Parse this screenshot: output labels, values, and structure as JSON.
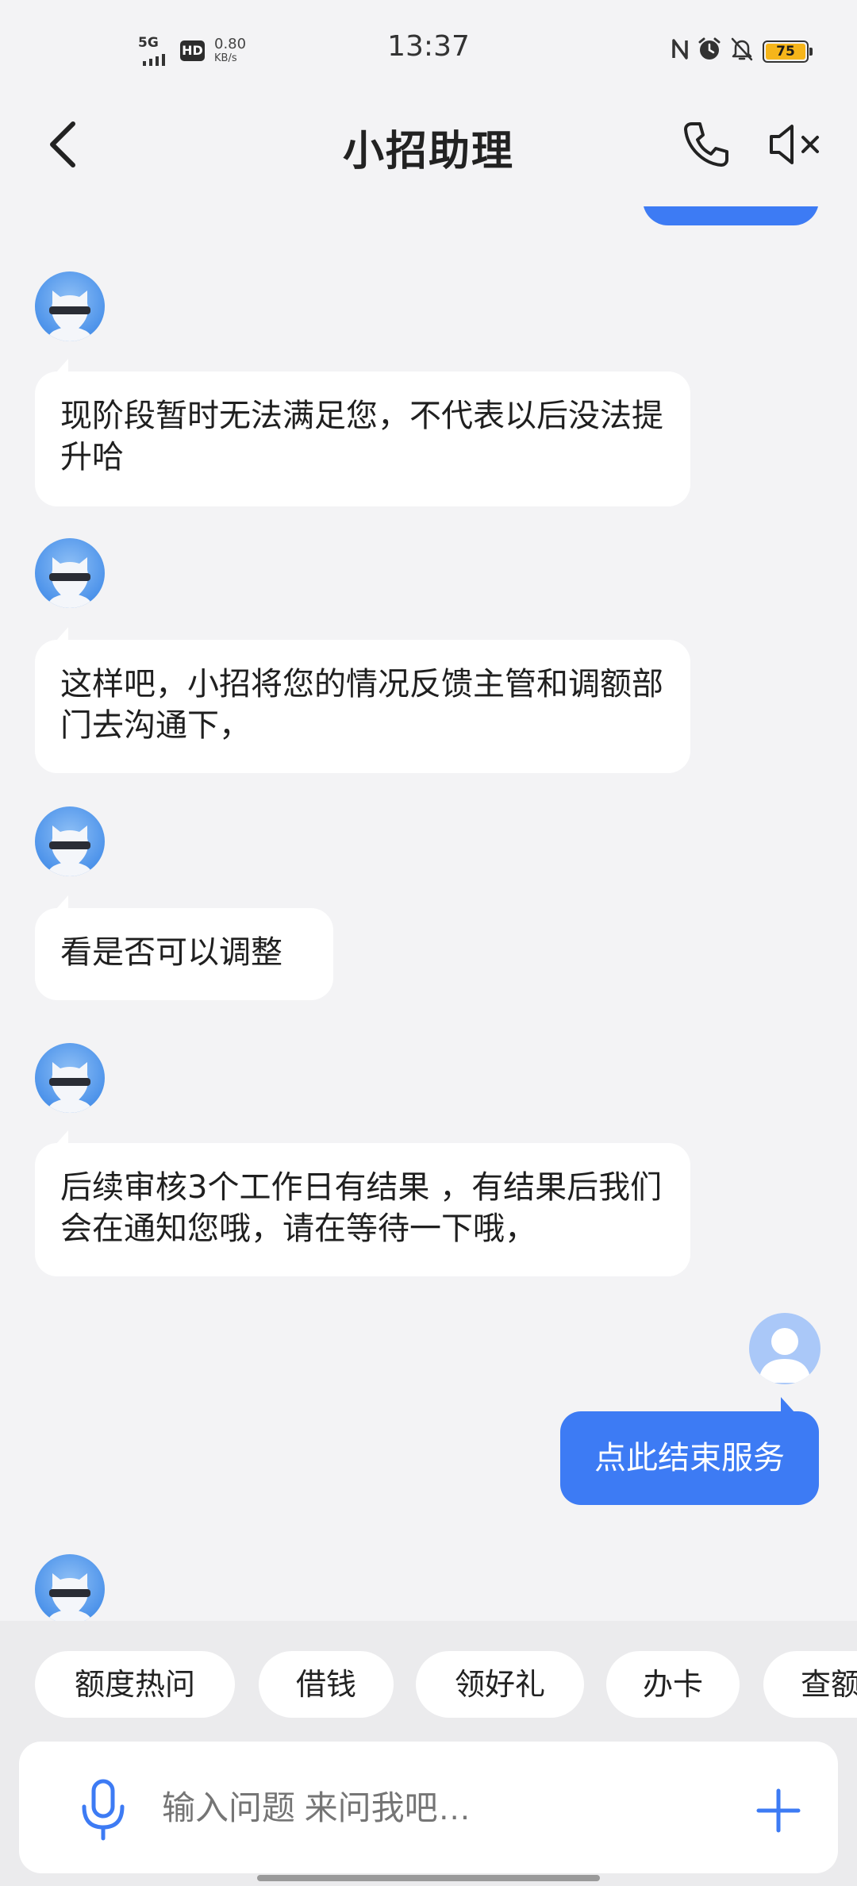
{
  "status_bar": {
    "network": "5G",
    "hd": "HD",
    "speed_value": "0.80",
    "speed_unit": "KB/s",
    "time": "13:37",
    "battery": "75"
  },
  "header": {
    "title": "小招助理"
  },
  "messages": [
    {
      "from": "bot",
      "text": "现阶段暂时无法满足您，不代表以后没法提升哈"
    },
    {
      "from": "bot",
      "text": "这样吧，小招将您的情况反馈主管和调额部门去沟通下，"
    },
    {
      "from": "bot",
      "text": "看是否可以调整"
    },
    {
      "from": "bot",
      "text": "后续审核3个工作日有结果 ，有结果后我们会在通知您哦，请在等待一下哦，"
    },
    {
      "from": "user",
      "text": "点此结束服务"
    }
  ],
  "quick_chips": [
    "额度热问",
    "借钱",
    "领好礼",
    "办卡",
    "查额"
  ],
  "input": {
    "placeholder": "输入问题 来问我吧…"
  },
  "colors": {
    "accent": "#3d7bf4",
    "background": "#f3f3f5",
    "bubble": "#ffffff",
    "battery": "#f6b51a"
  }
}
